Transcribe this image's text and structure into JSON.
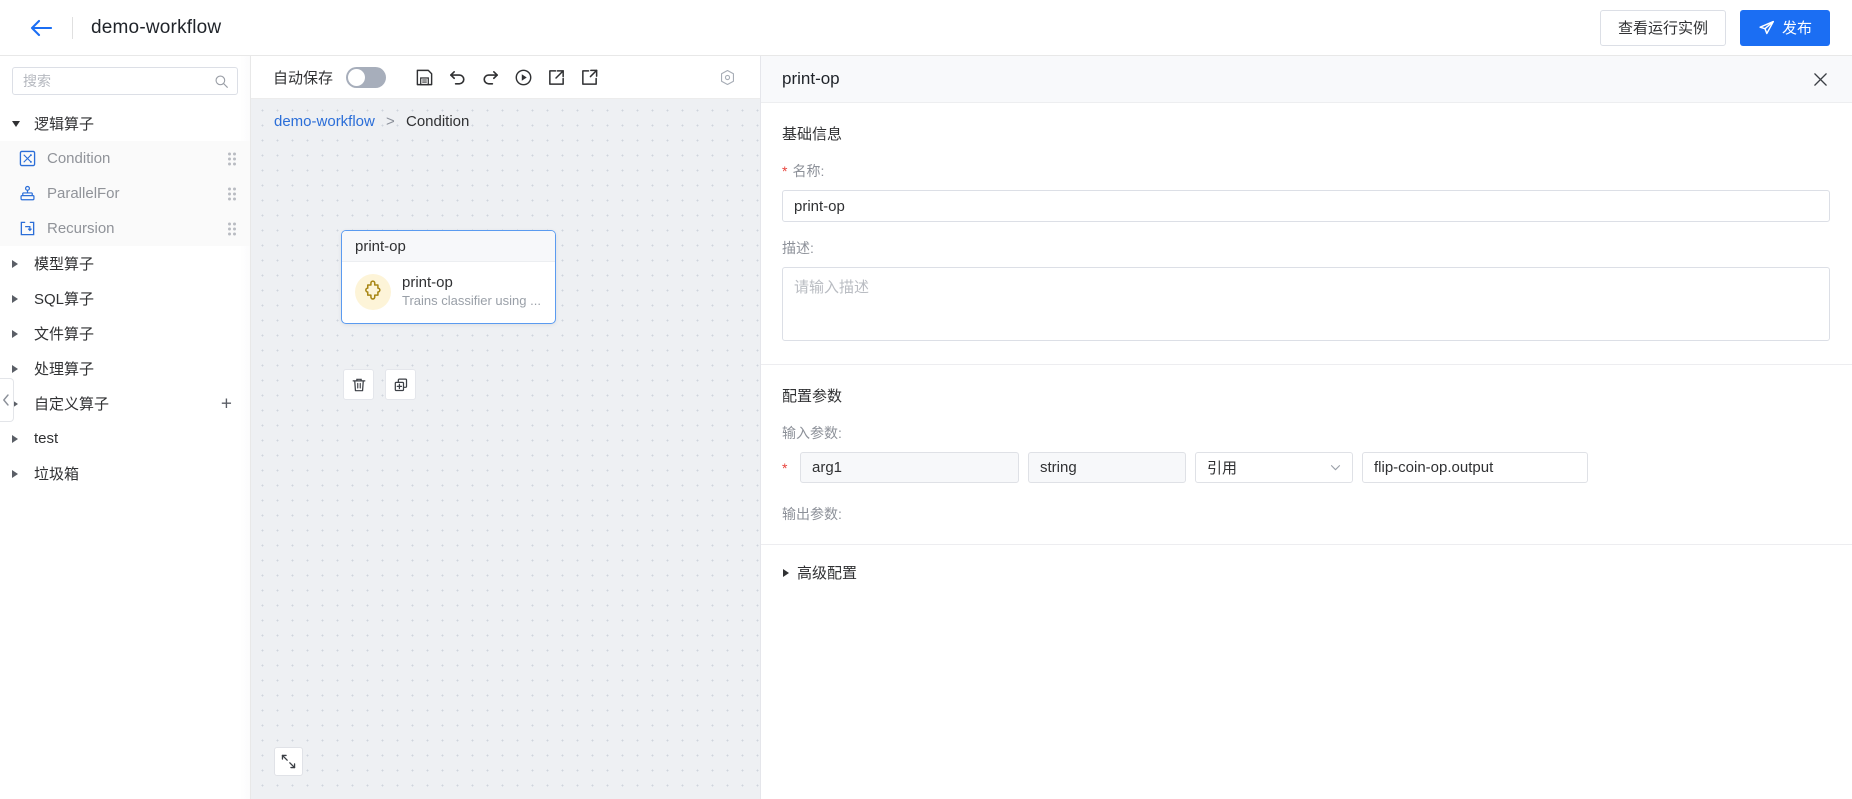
{
  "header": {
    "back_icon": "arrow-left-icon",
    "workflow_title": "demo-workflow",
    "view_instances_label": "查看运行实例",
    "publish_label": "发布",
    "publish_icon": "send-icon",
    "accent_color": "#1b6ef3"
  },
  "sidebar": {
    "search": {
      "placeholder": "搜索",
      "value": "",
      "icon": "search-icon"
    },
    "tree": [
      {
        "label": "逻辑算子",
        "type": "group",
        "expanded": true
      },
      {
        "label": "Condition",
        "type": "leaf",
        "icon": "condition-icon",
        "handle": "drag-handle-icon"
      },
      {
        "label": "ParallelFor",
        "type": "leaf",
        "icon": "parallel-for-icon",
        "handle": "drag-handle-icon"
      },
      {
        "label": "Recursion",
        "type": "leaf",
        "icon": "recursion-icon",
        "handle": "drag-handle-icon"
      },
      {
        "label": "模型算子",
        "type": "group",
        "expanded": false
      },
      {
        "label": "SQL算子",
        "type": "group",
        "expanded": false
      },
      {
        "label": "文件算子",
        "type": "group",
        "expanded": false
      },
      {
        "label": "处理算子",
        "type": "group",
        "expanded": false
      },
      {
        "label": "自定义算子",
        "type": "group",
        "expanded": false,
        "add_button": "+"
      },
      {
        "label": "test",
        "type": "group",
        "expanded": false
      },
      {
        "label": "垃圾箱",
        "type": "group",
        "expanded": false
      }
    ]
  },
  "toolbar": {
    "autosave_label": "自动保存",
    "autosave_on": false,
    "icons": [
      {
        "name": "save-icon",
        "title": "保存"
      },
      {
        "name": "undo-icon",
        "title": "撤销"
      },
      {
        "name": "redo-icon",
        "title": "重做"
      },
      {
        "name": "run-icon",
        "title": "运行"
      },
      {
        "name": "export-icon",
        "title": "导出"
      },
      {
        "name": "import-icon",
        "title": "导入"
      }
    ],
    "right_icon": "settings-hex-icon"
  },
  "canvas": {
    "breadcrumb": {
      "root": "demo-workflow",
      "separator": ">",
      "current": "Condition"
    },
    "node": {
      "header_label": "print-op",
      "title": "print-op",
      "subtitle": "Trains classifier using ...",
      "avatar_icon": "puzzle-icon",
      "avatar_bg": "#fdf4d8",
      "border_color": "#5b9bf0"
    },
    "node_actions": [
      {
        "name": "delete-node-button",
        "icon": "trash-icon"
      },
      {
        "name": "duplicate-node-button",
        "icon": "copy-plus-icon"
      }
    ],
    "fit_view_icon": "fit-view-icon",
    "collapse_icon": "chevron-left-icon"
  },
  "panel": {
    "title": "print-op",
    "close_icon": "close-icon",
    "basic_section": {
      "title": "基础信息",
      "name_label": "名称:",
      "name_value": "print-op",
      "desc_label": "描述:",
      "desc_value": "",
      "desc_placeholder": "请输入描述"
    },
    "config_section": {
      "title": "配置参数",
      "input_params_label": "输入参数:",
      "output_params_label": "输出参数:",
      "input_rows": [
        {
          "required": "*",
          "name": "arg1",
          "type": "string",
          "source": "引用",
          "value": "flip-coin-op.output",
          "dropdown_icon": "chevron-down-icon"
        }
      ]
    },
    "advanced_label": "高级配置",
    "advanced_expanded": false
  }
}
